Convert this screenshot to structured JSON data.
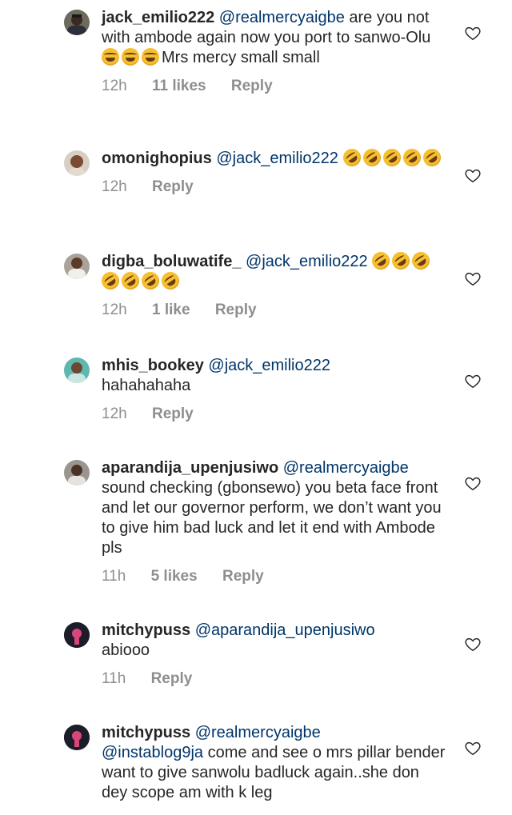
{
  "comments": [
    {
      "username": "jack_emilio222",
      "mention": "@realmercyaigbe",
      "text_before_emoji": " are you not with ambode again now you port to sanwo-Olu ",
      "emojis": [
        "joy",
        "joy",
        "joy"
      ],
      "text_after_emoji": "Mrs mercy small small",
      "time": "12h",
      "likes": "11 likes",
      "reply": "Reply"
    },
    {
      "username": "omonighopius",
      "mention": "@jack_emilio222",
      "emojis": [
        "rofl",
        "rofl",
        "rofl",
        "rofl",
        "rofl"
      ],
      "time": "12h",
      "reply": "Reply"
    },
    {
      "username": "digba_boluwatife_",
      "mention": "@jack_emilio222",
      "emojis": [
        "rofl",
        "rofl",
        "rofl",
        "rofl",
        "rofl",
        "rofl",
        "rofl"
      ],
      "time": "12h",
      "likes": "1 like",
      "reply": "Reply"
    },
    {
      "username": "mhis_bookey",
      "mention": "@jack_emilio222",
      "text": "hahahahaha",
      "time": "12h",
      "reply": "Reply"
    },
    {
      "username": "aparandija_upenjusiwo",
      "mention": "@realmercyaigbe",
      "text": "sound checking (gbonsewo) you beta face front and let our governor perform, we don’t want you to give him bad luck and let it end with Ambode pls",
      "time": "11h",
      "likes": "5 likes",
      "reply": "Reply"
    },
    {
      "username": "mitchypuss",
      "mention": "@aparandija_upenjusiwo",
      "text": "abiooo",
      "time": "11h",
      "reply": "Reply"
    },
    {
      "username": "mitchypuss",
      "mention": "@realmercyaigbe",
      "mention2": "@instablog9ja",
      "text": "come and see o mrs pillar bender want to give sanwolu badluck again..she don dey scope am with k leg"
    }
  ],
  "icons": {
    "like": "heart-outline-icon"
  },
  "colors": {
    "text": "#262626",
    "meta": "#8e8e8e",
    "mention": "#003569"
  }
}
